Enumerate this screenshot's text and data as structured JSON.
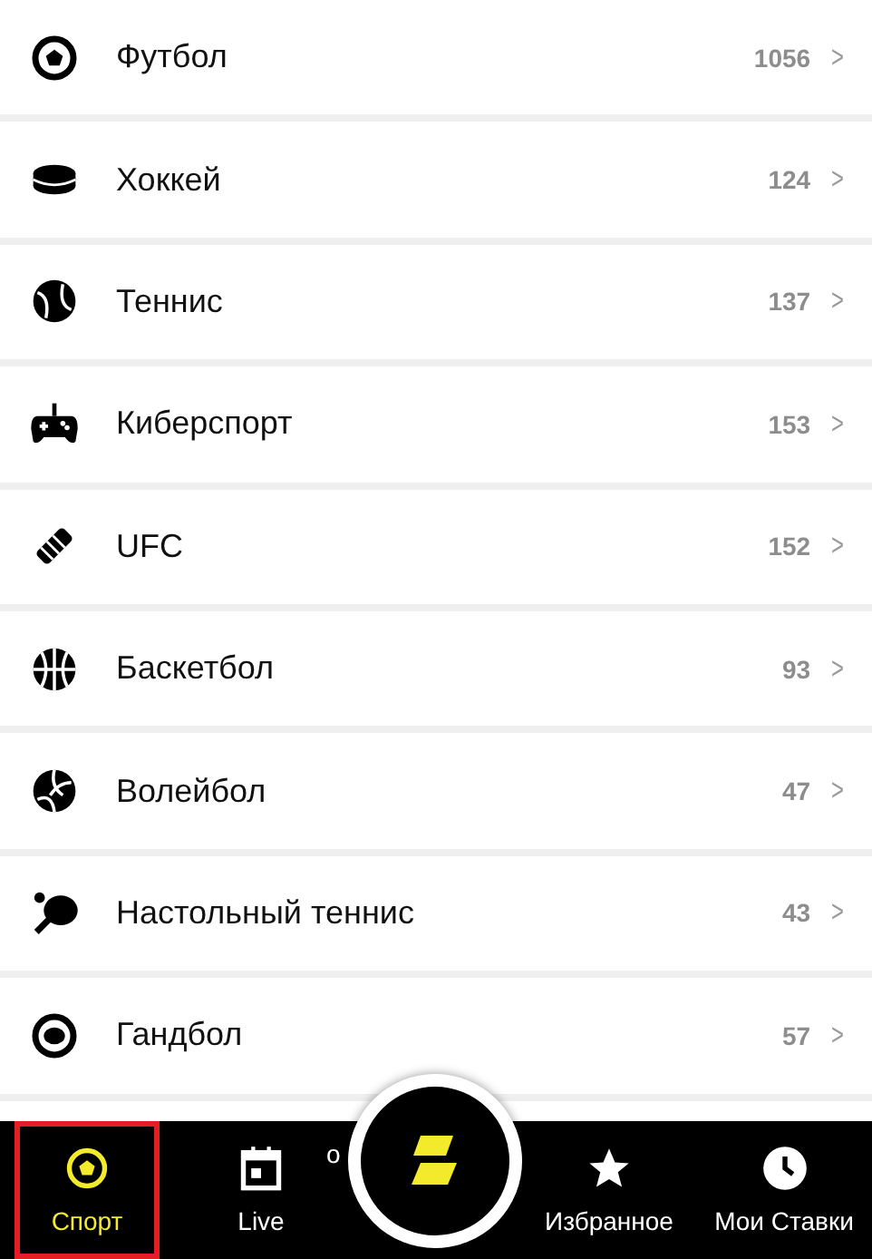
{
  "sports": [
    {
      "name": "Футбол",
      "count": "1056",
      "kind": "football"
    },
    {
      "name": "Хоккей",
      "count": "124",
      "kind": "hockey"
    },
    {
      "name": "Теннис",
      "count": "137",
      "kind": "tennis"
    },
    {
      "name": "Киберспорт",
      "count": "153",
      "kind": "esports"
    },
    {
      "name": "UFC",
      "count": "152",
      "kind": "ufc"
    },
    {
      "name": "Баскетбол",
      "count": "93",
      "kind": "basketball"
    },
    {
      "name": "Волейбол",
      "count": "47",
      "kind": "volleyball"
    },
    {
      "name": "Настольный теннис",
      "count": "43",
      "kind": "tabletennis"
    },
    {
      "name": "Гандбол",
      "count": "57",
      "kind": "handball"
    }
  ],
  "chevron": ">",
  "hidden_label": "о",
  "tabs": [
    {
      "label": "Спорт",
      "kind": "ball",
      "selected": true
    },
    {
      "label": "Live",
      "kind": "calendar",
      "selected": false
    },
    {
      "kind": "logo",
      "selected": false
    },
    {
      "label": "Избранное",
      "kind": "star",
      "selected": false
    },
    {
      "label": "Мои Ставки",
      "kind": "clock",
      "selected": false
    }
  ]
}
